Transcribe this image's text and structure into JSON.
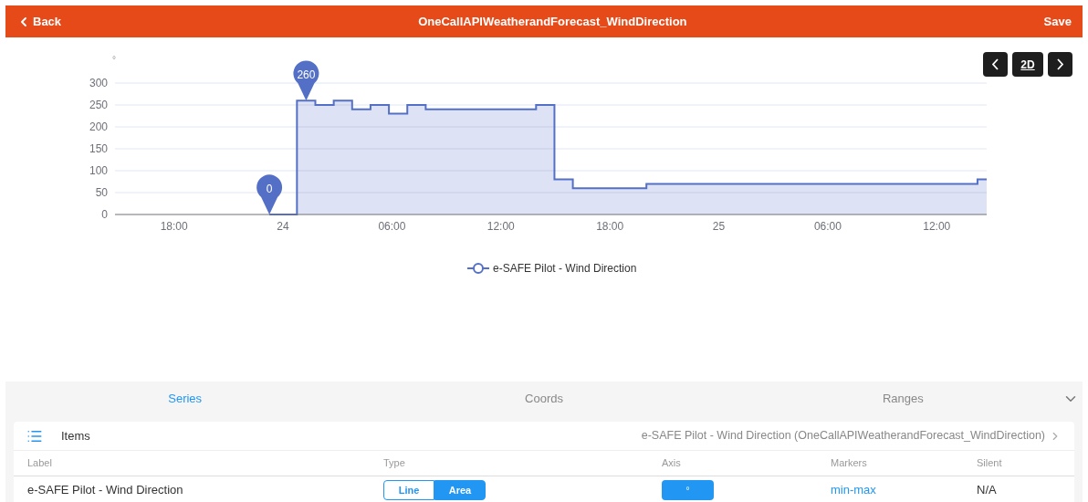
{
  "header": {
    "back": "Back",
    "title": "OneCallAPIWeatherandForecast_WindDirection",
    "save": "Save"
  },
  "chart_nav": {
    "zoom_label": "2D"
  },
  "chart": {
    "x_axis_labels": [
      "18:00",
      "24",
      "06:00",
      "12:00",
      "18:00",
      "25",
      "06:00",
      "12:00"
    ],
    "chart_data": {
      "type": "area",
      "grid": true,
      "ylabel": "°",
      "ylim": [
        0,
        300
      ],
      "yticks": [
        0,
        50,
        100,
        150,
        200,
        250,
        300
      ],
      "series": [
        {
          "name": "e-SAFE Pilot - Wind Direction",
          "color": "#5470c6",
          "values": [
            0,
            0,
            260,
            250,
            260,
            240,
            250,
            230,
            250,
            240,
            240,
            240,
            240,
            240,
            240,
            250,
            80,
            60,
            60,
            60,
            60,
            70,
            70,
            70,
            70,
            70,
            70,
            70,
            70,
            70,
            70,
            70,
            70,
            70,
            70,
            70,
            70,
            70,
            70,
            80
          ]
        }
      ],
      "annotations": [
        {
          "text": "260"
        },
        {
          "text": "0"
        }
      ]
    }
  },
  "tabs": [
    {
      "label": "Series",
      "selected": true
    },
    {
      "label": "Coords",
      "selected": false
    },
    {
      "label": "Ranges",
      "selected": false
    }
  ],
  "items": {
    "title": "Items",
    "current": "e-SAFE Pilot - Wind Direction (OneCallAPIWeatherandForecast_WindDirection)",
    "columns": [
      "Label",
      "Type",
      "Axis",
      "Markers",
      "Silent"
    ],
    "rows": [
      {
        "label": "e-SAFE Pilot - Wind Direction",
        "types": [
          {
            "label": "Line",
            "selected": false
          },
          {
            "label": "Area",
            "selected": true
          }
        ],
        "axis": "°",
        "markers": "min-max",
        "silent": "N/A"
      }
    ]
  }
}
